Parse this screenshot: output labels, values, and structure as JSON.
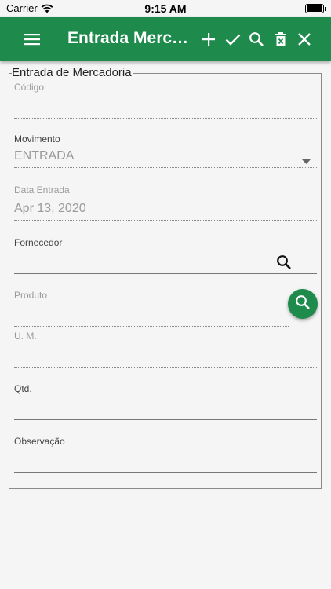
{
  "status_bar": {
    "carrier": "Carrier",
    "time": "9:15 AM"
  },
  "appbar": {
    "title": "Entrada Mercadoria",
    "color": "#1e8a4c",
    "actions": [
      "menu-icon",
      "add-icon",
      "check-icon",
      "search-icon",
      "delete-icon",
      "close-icon"
    ]
  },
  "form": {
    "legend": "Entrada de Mercadoria",
    "codigo": {
      "label": "Código",
      "value": ""
    },
    "movimento": {
      "label": "Movimento",
      "value": "ENTRADA"
    },
    "data_entrada": {
      "label": "Data Entrada",
      "value": "Apr 13, 2020"
    },
    "fornecedor": {
      "label": "Fornecedor",
      "value": ""
    },
    "produto": {
      "label": "Produto",
      "value": ""
    },
    "um": {
      "label": "U. M.",
      "value": ""
    },
    "qtd": {
      "label": "Qtd.",
      "value": ""
    },
    "observacao": {
      "label": "Observação",
      "value": ""
    }
  }
}
